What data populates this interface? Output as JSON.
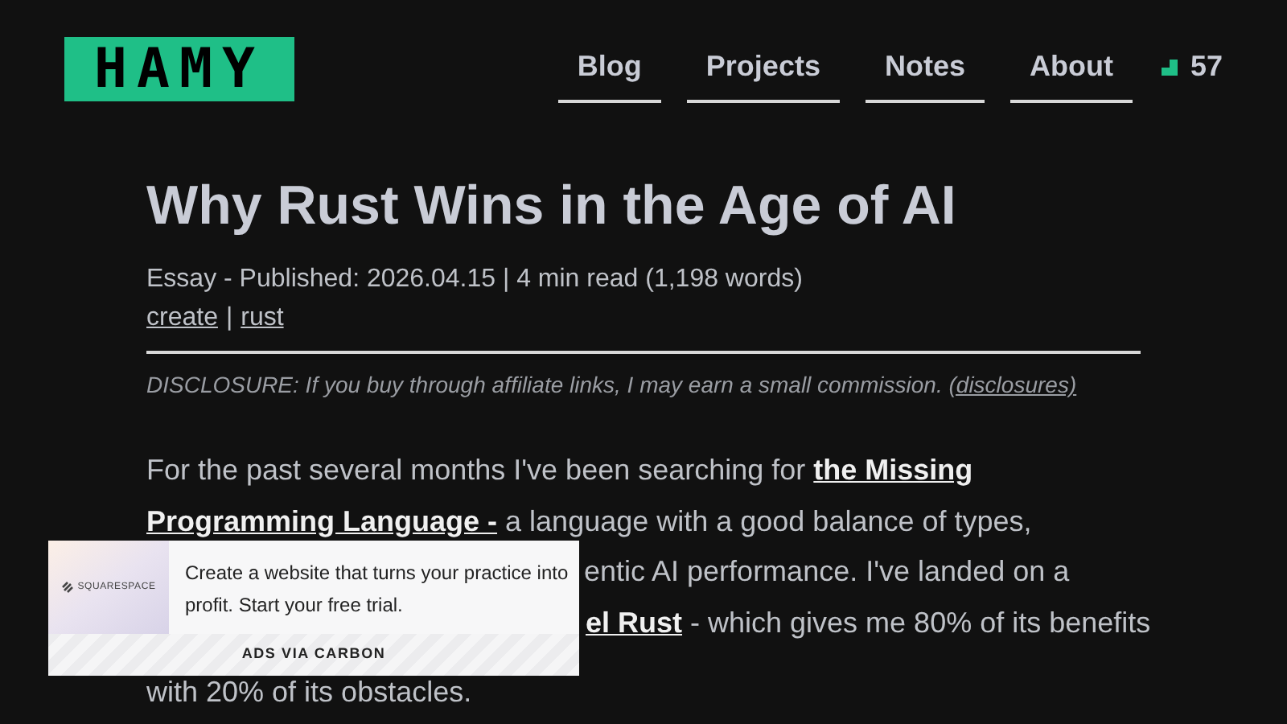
{
  "logo": {
    "text": "HAMY"
  },
  "nav": [
    {
      "label": "Blog"
    },
    {
      "label": "Projects"
    },
    {
      "label": "Notes"
    },
    {
      "label": "About"
    }
  ],
  "stars": {
    "count": "57"
  },
  "article": {
    "title": "Why Rust Wins in the Age of AI",
    "meta": "Essay - Published: 2026.04.15 | 4 min read (1,198 words)",
    "tags": [
      "create",
      "rust"
    ],
    "tag_separator": "|",
    "disclosure": "DISCLOSURE: If you buy through affiliate links, I may earn a small commission.",
    "disclosure_link": "(disclosures)",
    "lines": [
      {
        "parts": [
          {
            "text": "For the past several months I've been searching for ",
            "kind": "plain"
          },
          {
            "text": "the Missing",
            "kind": "link"
          }
        ]
      },
      {
        "parts": [
          {
            "text": "Programming Language -",
            "kind": "link"
          },
          {
            "text": " a language with a good balance of types,",
            "kind": "plain"
          }
        ]
      },
      {
        "indent": true,
        "parts": [
          {
            "text": "entic AI performance. I've landed on a",
            "kind": "plain"
          }
        ]
      },
      {
        "indent": true,
        "parts": [
          {
            "text": "el Rust",
            "kind": "link"
          },
          {
            "text": " - which gives me 80% of its benefits",
            "kind": "plain"
          }
        ]
      },
      {
        "parts": [
          {
            "text": "with 20% of its obstacles.",
            "kind": "plain"
          }
        ]
      }
    ]
  },
  "ad": {
    "brand": "SQUARESPACE",
    "text": "Create a website that turns your practice into profit. Start your free trial.",
    "footer": "ADS VIA CARBON"
  }
}
